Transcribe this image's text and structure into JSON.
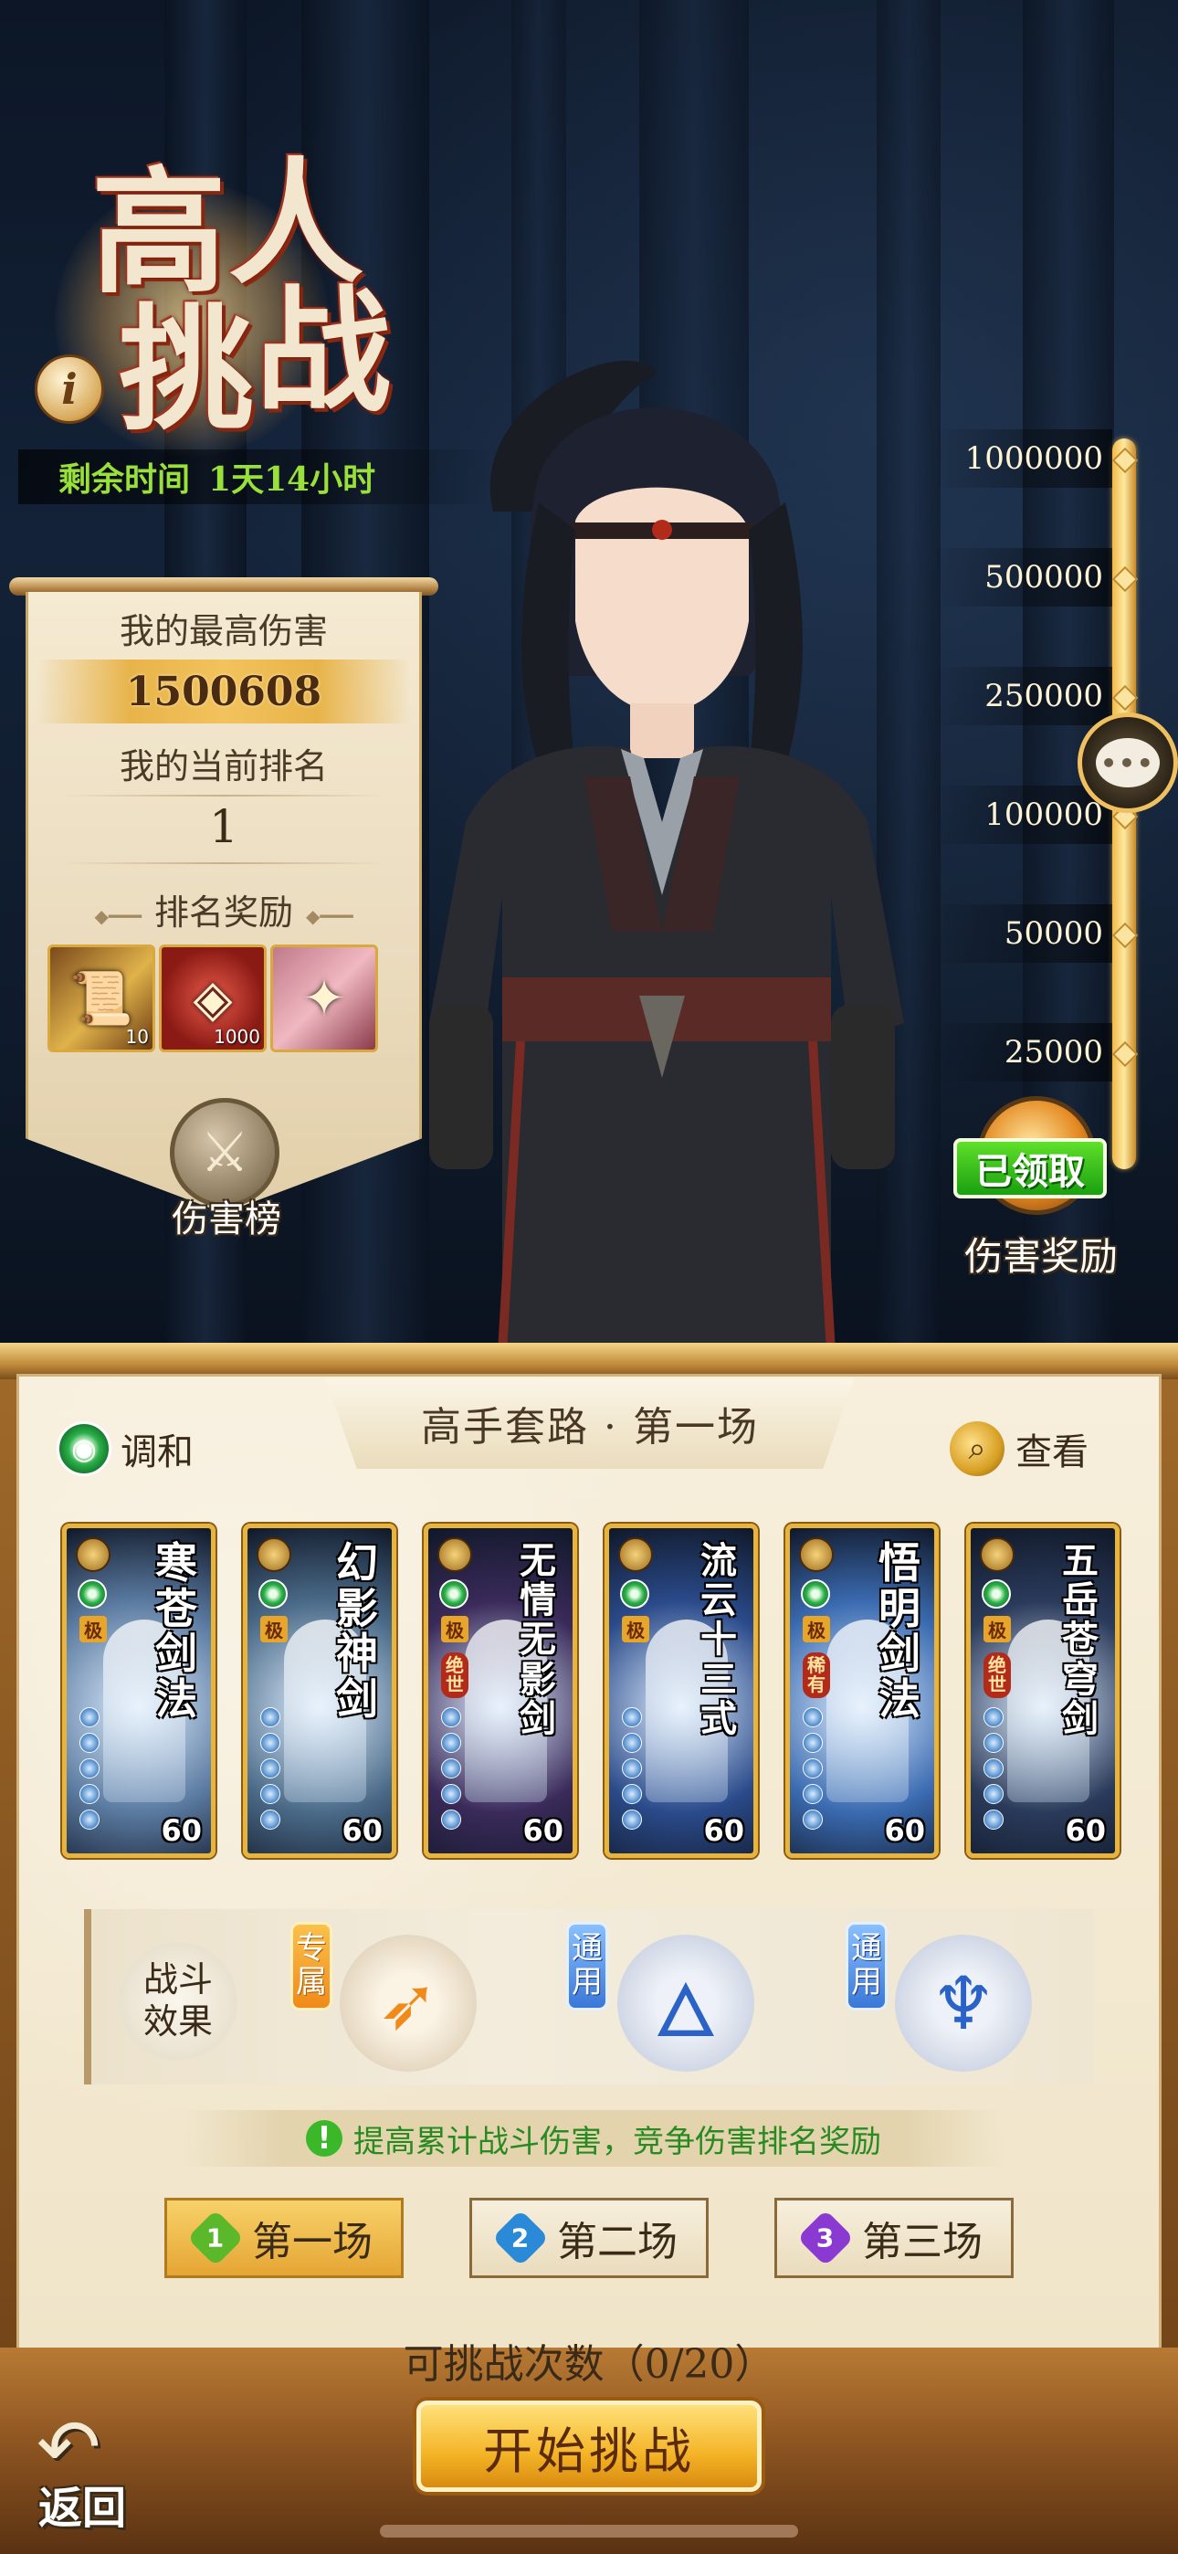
{
  "event": {
    "title_chars": [
      "高",
      "人",
      "挑",
      "战"
    ],
    "info_label": "i",
    "remaining_label": "剩余时间",
    "remaining_value": "1天14小时"
  },
  "stats": {
    "best_damage_label": "我的最高伤害",
    "best_damage_value": "1500608",
    "current_rank_label": "我的当前排名",
    "current_rank_value": "1",
    "rank_rewards_label": "排名奖励",
    "rewards": [
      {
        "count": "10"
      },
      {
        "count": "1000"
      },
      {
        "count": ""
      }
    ],
    "damage_board_label": "伤害榜"
  },
  "ladder": {
    "tiers": [
      "1000000",
      "500000",
      "250000",
      "100000",
      "50000",
      "25000"
    ],
    "chat_glyph": "•••",
    "claimed_label": "已领取",
    "damage_reward_label": "伤害奖励"
  },
  "panel": {
    "stage_title": "高手套路 · 第一场",
    "harmony_label": "调和",
    "view_label": "查看",
    "cards": [
      {
        "name": [
          "寒",
          "苍",
          "剑",
          "法"
        ],
        "tier_tag": "极",
        "special_tag": "",
        "level": "60",
        "color": "#5a7aa0"
      },
      {
        "name": [
          "幻",
          "影",
          "神",
          "剑"
        ],
        "tier_tag": "极",
        "special_tag": "",
        "level": "60",
        "color": "#4a6a88"
      },
      {
        "name": [
          "无",
          "情",
          "无",
          "影",
          "剑"
        ],
        "tier_tag": "极",
        "special_tag": "绝世",
        "level": "60",
        "color": "#3a2a5a"
      },
      {
        "name": [
          "流",
          "云",
          "十",
          "三",
          "式"
        ],
        "tier_tag": "极",
        "special_tag": "",
        "level": "60",
        "color": "#2a4a8a"
      },
      {
        "name": [
          "悟",
          "明",
          "剑",
          "法"
        ],
        "tier_tag": "极",
        "special_tag": "稀有",
        "level": "60",
        "color": "#3a6ab0"
      },
      {
        "name": [
          "五",
          "岳",
          "苍",
          "穹",
          "剑"
        ],
        "tier_tag": "极",
        "special_tag": "绝世",
        "level": "60",
        "color": "#2a3a5a"
      }
    ],
    "effects": {
      "label": "战斗效果",
      "items": [
        {
          "tag": "专属",
          "icon": "arrow-icon"
        },
        {
          "tag": "通用",
          "icon": "flame-icon"
        },
        {
          "tag": "通用",
          "icon": "figure-icon"
        }
      ]
    },
    "hint": "提高累计战斗伤害，竞争伤害排名奖励",
    "stages": [
      {
        "num": "1",
        "label": "第一场"
      },
      {
        "num": "2",
        "label": "第二场"
      },
      {
        "num": "3",
        "label": "第三场"
      }
    ],
    "attempts_label": "可挑战次数（0/20）",
    "start_label": "开始挑战",
    "back_label": "返回"
  }
}
